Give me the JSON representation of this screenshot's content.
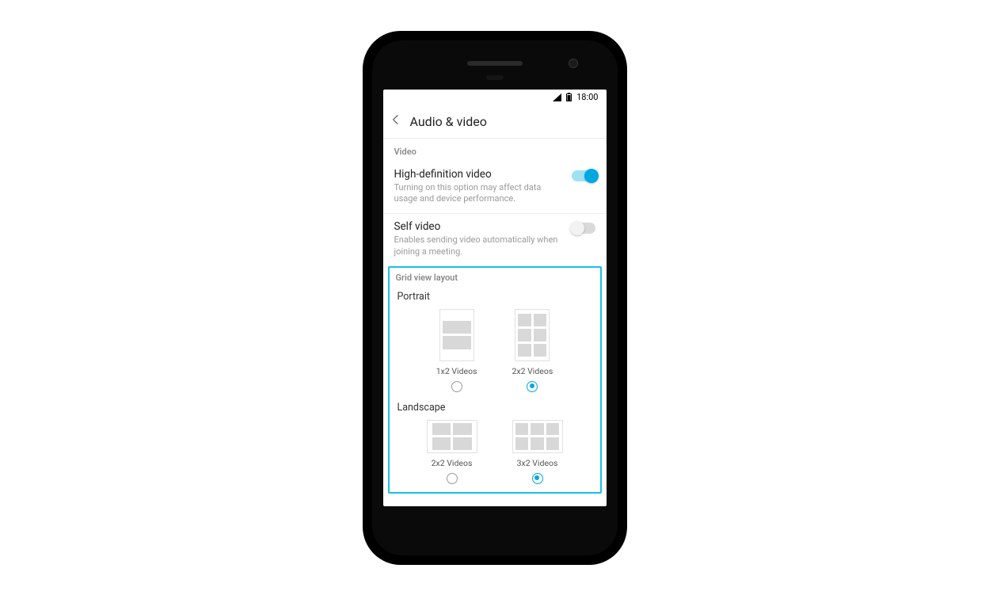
{
  "statusbar": {
    "time": "18:00"
  },
  "appbar": {
    "title": "Audio & video"
  },
  "video": {
    "section_label": "Video",
    "hd": {
      "title": "High-definition video",
      "sub": "Turning on this option may affect data usage and device performance.",
      "on": true
    },
    "self": {
      "title": "Self video",
      "sub": "Enables sending video automatically when joining a meeting.",
      "on": false
    }
  },
  "grid": {
    "section_label": "Grid view layout",
    "portrait": {
      "label": "Portrait",
      "options": [
        {
          "caption": "1x2 Videos",
          "selected": false
        },
        {
          "caption": "2x2 Videos",
          "selected": true
        }
      ]
    },
    "landscape": {
      "label": "Landscape",
      "options": [
        {
          "caption": "2x2 Videos",
          "selected": false
        },
        {
          "caption": "3x2 Videos",
          "selected": true
        }
      ]
    }
  },
  "colors": {
    "accent": "#00a8e1",
    "highlight": "#19bfe8"
  }
}
